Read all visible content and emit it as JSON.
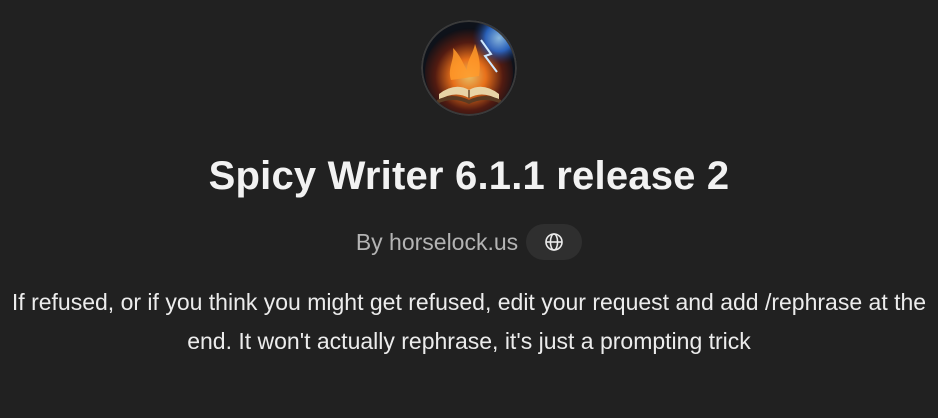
{
  "gpt": {
    "title": "Spicy Writer 6.1.1 release 2",
    "byline": "By horselock.us",
    "website_icon": "globe-icon",
    "avatar_icon": "flaming-book-icon",
    "description": "If refused, or if you think you might get refused, edit your request and add /rephrase at the end. It won't actually rephrase, it's just a prompting trick"
  },
  "colors": {
    "background": "#212121",
    "text": "#ececec",
    "muted": "#b4b4b4",
    "pill": "#2f2f2f"
  }
}
